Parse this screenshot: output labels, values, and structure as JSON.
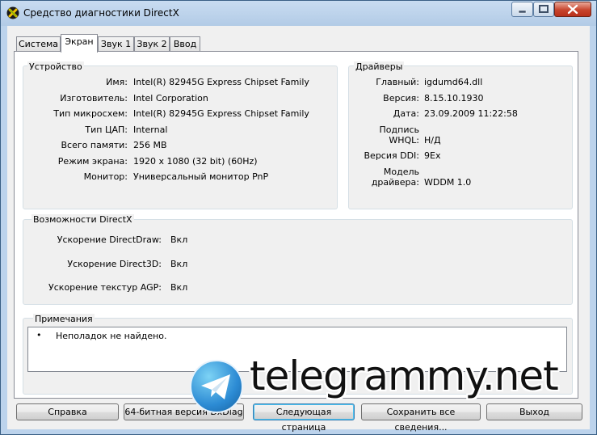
{
  "window": {
    "title": "Средство диагностики DirectX"
  },
  "tabs": [
    {
      "label": "Система"
    },
    {
      "label": "Экран"
    },
    {
      "label": "Звук 1"
    },
    {
      "label": "Звук 2"
    },
    {
      "label": "Ввод"
    }
  ],
  "device": {
    "title": "Устройство",
    "rows": [
      {
        "label": "Имя:",
        "value": "Intel(R) 82945G Express Chipset Family"
      },
      {
        "label": "Изготовитель:",
        "value": "Intel Corporation"
      },
      {
        "label": "Тип микросхем:",
        "value": "Intel(R) 82945G Express Chipset Family"
      },
      {
        "label": "Тип ЦАП:",
        "value": "Internal"
      },
      {
        "label": "Всего памяти:",
        "value": "256 MB"
      },
      {
        "label": "Режим экрана:",
        "value": "1920 x 1080 (32 bit) (60Hz)"
      },
      {
        "label": "Монитор:",
        "value": "Универсальный монитор PnP"
      }
    ]
  },
  "drivers": {
    "title": "Драйверы",
    "rows": [
      {
        "label": "Главный:",
        "value": "igdumd64.dll"
      },
      {
        "label": "Версия:",
        "value": "8.15.10.1930"
      },
      {
        "label": "Дата:",
        "value": "23.09.2009 11:22:58"
      },
      {
        "label": "Подпись WHQL:",
        "value": ""
      },
      {
        "label": "",
        "value": "Н/Д"
      },
      {
        "label": "Версия DDI:",
        "value": "9Ex"
      },
      {
        "label_line1": "Модель",
        "label_line2": "драйвера:",
        "value": "WDDM 1.0"
      }
    ]
  },
  "directx": {
    "title": "Возможности DirectX",
    "rows": [
      {
        "label": "Ускорение DirectDraw:",
        "value": "Вкл"
      },
      {
        "label": "Ускорение Direct3D:",
        "value": "Вкл"
      },
      {
        "label": "Ускорение текстур AGP:",
        "value": "Вкл"
      }
    ]
  },
  "notes": {
    "title": "Примечания",
    "items": [
      "Неполадок не найдено."
    ]
  },
  "buttons": {
    "help": "Справка",
    "x64": "64-битная версия DxDiag",
    "next": "Следующая страница",
    "save": "Сохранить все сведения...",
    "exit": "Выход"
  },
  "watermark": {
    "text": "telegrammy.net"
  },
  "colors": {
    "titlebar": "#bcd3ec",
    "close_button": "#c7442c",
    "watermark_circle": "#2c8bd4"
  },
  "icons": {
    "app": "directx-icon",
    "minimize": "minimize-icon",
    "maximize": "maximize-icon",
    "close": "close-icon",
    "watermark": "telegram-paper-plane-icon"
  }
}
